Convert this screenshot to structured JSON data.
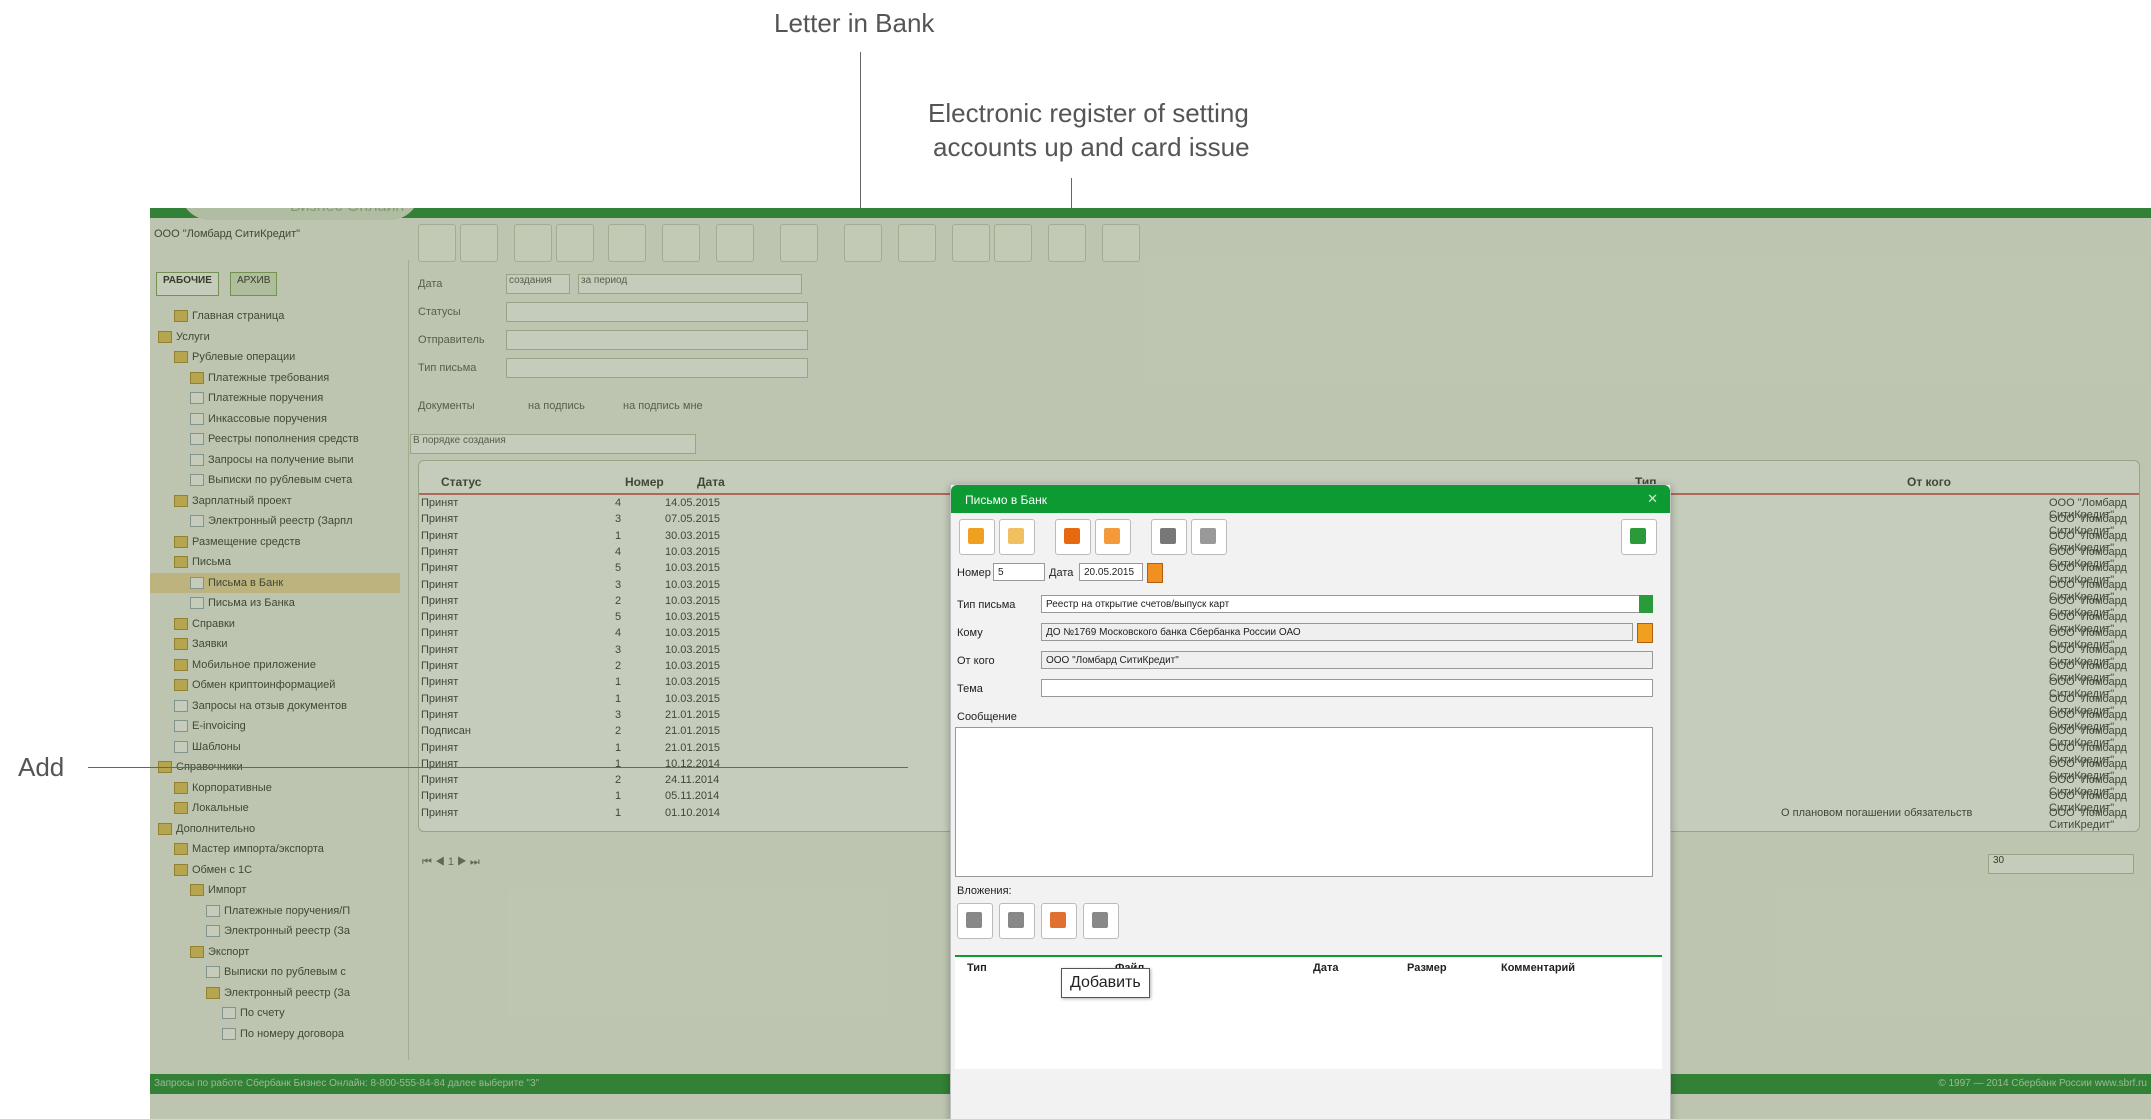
{
  "annotations": {
    "letter_in_bank": "Letter in Bank",
    "electronic_register_line1": "Electronic register of setting",
    "electronic_register_line2": "accounts up and card issue",
    "add": "Add"
  },
  "app": {
    "org_name": "ООО \"Ломбард СитиКредит\"",
    "tabs": [
      "РАБОЧИЕ",
      "АРХИВ"
    ],
    "tree": [
      {
        "label": "Главная страница",
        "level": 1,
        "type": "folder"
      },
      {
        "label": "Услуги",
        "level": 0,
        "type": "folder"
      },
      {
        "label": "Рублевые операции",
        "level": 1,
        "type": "folder"
      },
      {
        "label": "Платежные требования",
        "level": 2,
        "type": "folder"
      },
      {
        "label": "Платежные поручения",
        "level": 2,
        "type": "doc"
      },
      {
        "label": "Инкассовые поручения",
        "level": 2,
        "type": "doc"
      },
      {
        "label": "Реестры пополнения средств",
        "level": 2,
        "type": "doc"
      },
      {
        "label": "Запросы на получение выпи",
        "level": 2,
        "type": "doc"
      },
      {
        "label": "Выписки по рублевым счета",
        "level": 2,
        "type": "doc"
      },
      {
        "label": "Зарплатный проект",
        "level": 1,
        "type": "folder"
      },
      {
        "label": "Электронный реестр (Зарпл",
        "level": 2,
        "type": "doc"
      },
      {
        "label": "Размещение средств",
        "level": 1,
        "type": "folder"
      },
      {
        "label": "Письма",
        "level": 1,
        "type": "folder"
      },
      {
        "label": "Письма в Банк",
        "level": 2,
        "type": "doc",
        "selected": true
      },
      {
        "label": "Письма из Банка",
        "level": 2,
        "type": "doc"
      },
      {
        "label": "Справки",
        "level": 1,
        "type": "folder"
      },
      {
        "label": "Заявки",
        "level": 1,
        "type": "folder"
      },
      {
        "label": "Мобильное приложение",
        "level": 1,
        "type": "folder"
      },
      {
        "label": "Обмен криптоинформацией",
        "level": 1,
        "type": "folder"
      },
      {
        "label": "Запросы на отзыв документов",
        "level": 1,
        "type": "doc"
      },
      {
        "label": "E-invoicing",
        "level": 1,
        "type": "doc"
      },
      {
        "label": "Шаблоны",
        "level": 1,
        "type": "doc"
      },
      {
        "label": "Справочники",
        "level": 0,
        "type": "folder"
      },
      {
        "label": "Корпоративные",
        "level": 1,
        "type": "folder"
      },
      {
        "label": "Локальные",
        "level": 1,
        "type": "folder"
      },
      {
        "label": "Дополнительно",
        "level": 0,
        "type": "folder"
      },
      {
        "label": "Мастер импорта/экспорта",
        "level": 1,
        "type": "folder"
      },
      {
        "label": "Обмен с 1С",
        "level": 1,
        "type": "folder"
      },
      {
        "label": "Импорт",
        "level": 2,
        "type": "folder"
      },
      {
        "label": "Платежные поручения/П",
        "level": 3,
        "type": "doc"
      },
      {
        "label": "Электронный реестр (За",
        "level": 3,
        "type": "doc"
      },
      {
        "label": "Экспорт",
        "level": 2,
        "type": "folder"
      },
      {
        "label": "Выписки по рублевым с",
        "level": 3,
        "type": "doc"
      },
      {
        "label": "Электронный реестр (За",
        "level": 3,
        "type": "folder"
      },
      {
        "label": "По счету",
        "level": 4,
        "type": "doc"
      },
      {
        "label": "По номеру договора",
        "level": 4,
        "type": "doc"
      }
    ],
    "filters": {
      "date_label": "Дата",
      "date_value": "создания",
      "period_value": "за период",
      "status_label": "Статусы",
      "sender_label": "Отправитель",
      "type_label": "Тип письма",
      "documents_label": "Документы",
      "on_sign_label": "на подпись",
      "on_sign_me_label": "на подпись мне",
      "sort_value": "В порядке создания"
    },
    "grid": {
      "columns": [
        "Статус",
        "Номер",
        "Дата",
        "Тип",
        "От кого"
      ],
      "rows": [
        {
          "status": "Принят",
          "num": "4",
          "date": "14.05.2015",
          "type": "",
          "from": "ООО \"Ломбард СитиКредит\""
        },
        {
          "status": "Принят",
          "num": "3",
          "date": "07.05.2015",
          "type": "",
          "from": "ООО \"Ломбард СитиКредит\""
        },
        {
          "status": "Принят",
          "num": "1",
          "date": "30.03.2015",
          "type": "",
          "from": "ООО \"Ломбард СитиКредит\""
        },
        {
          "status": "Принят",
          "num": "4",
          "date": "10.03.2015",
          "type": "",
          "from": "ООО \"Ломбард СитиКредит\""
        },
        {
          "status": "Принят",
          "num": "5",
          "date": "10.03.2015",
          "type": "",
          "from": "ООО \"Ломбард СитиКредит\""
        },
        {
          "status": "Принят",
          "num": "3",
          "date": "10.03.2015",
          "type": "",
          "from": "ООО \"Ломбард СитиКредит\""
        },
        {
          "status": "Принят",
          "num": "2",
          "date": "10.03.2015",
          "type": "",
          "from": "ООО \"Ломбард СитиКредит\""
        },
        {
          "status": "Принят",
          "num": "5",
          "date": "10.03.2015",
          "type": "",
          "from": "ООО \"Ломбард СитиКредит\""
        },
        {
          "status": "Принят",
          "num": "4",
          "date": "10.03.2015",
          "type": "",
          "from": "ООО \"Ломбард СитиКредит\""
        },
        {
          "status": "Принят",
          "num": "3",
          "date": "10.03.2015",
          "type": "",
          "from": "ООО \"Ломбард СитиКредит\""
        },
        {
          "status": "Принят",
          "num": "2",
          "date": "10.03.2015",
          "type": "",
          "from": "ООО \"Ломбард СитиКредит\""
        },
        {
          "status": "Принят",
          "num": "1",
          "date": "10.03.2015",
          "type": "",
          "from": "ООО \"Ломбард СитиКредит\""
        },
        {
          "status": "Принят",
          "num": "1",
          "date": "10.03.2015",
          "type": "",
          "from": "ООО \"Ломбард СитиКредит\""
        },
        {
          "status": "Принят",
          "num": "3",
          "date": "21.01.2015",
          "type": "",
          "from": "ООО \"Ломбард СитиКредит\""
        },
        {
          "status": "Подписан",
          "num": "2",
          "date": "21.01.2015",
          "type": "",
          "from": "ООО \"Ломбард СитиКредит\""
        },
        {
          "status": "Принят",
          "num": "1",
          "date": "21.01.2015",
          "type": "",
          "from": "ООО \"Ломбард СитиКредит\""
        },
        {
          "status": "Принят",
          "num": "1",
          "date": "10.12.2014",
          "type": "",
          "from": "ООО \"Ломбард СитиКредит\""
        },
        {
          "status": "Принят",
          "num": "2",
          "date": "24.11.2014",
          "type": "",
          "from": "ООО \"Ломбард СитиКредит\""
        },
        {
          "status": "Принят",
          "num": "1",
          "date": "05.11.2014",
          "type": "",
          "from": "ООО \"Ломбард СитиКредит\""
        },
        {
          "status": "Принят",
          "num": "1",
          "date": "01.10.2014",
          "type": "О плановом погашении обязательств",
          "from": "ООО \"Ломбард СитиКредит\""
        }
      ],
      "page": "1",
      "page_size": "30"
    },
    "status_bar": {
      "left": "Запросы по работе Сбербанк Бизнес Онлайн: 8-800-555-84-84 далее выберите \"3\"",
      "right": "© 1997 — 2014 Сбербанк России  www.sbrf.ru"
    }
  },
  "dialog": {
    "title": "Письмо в Банк",
    "number_label": "Номер",
    "number_value": "5",
    "date_label": "Дата",
    "date_value": "20.05.2015",
    "type_label": "Тип письма",
    "type_value": "Реестр на открытие счетов/выпуск карт",
    "to_label": "Кому",
    "to_value": "ДО №1769 Московского банка Сбербанка России ОАО",
    "from_label": "От кого",
    "from_value": "ООО \"Ломбард СитиКредит\"",
    "subject_label": "Тема",
    "subject_value": "",
    "message_label": "Сообщение",
    "attachments_label": "Вложения:",
    "attachment_columns": [
      "Тип",
      "Файл",
      "Дата",
      "Размер",
      "Комментарий"
    ],
    "tooltip": "Добавить"
  }
}
